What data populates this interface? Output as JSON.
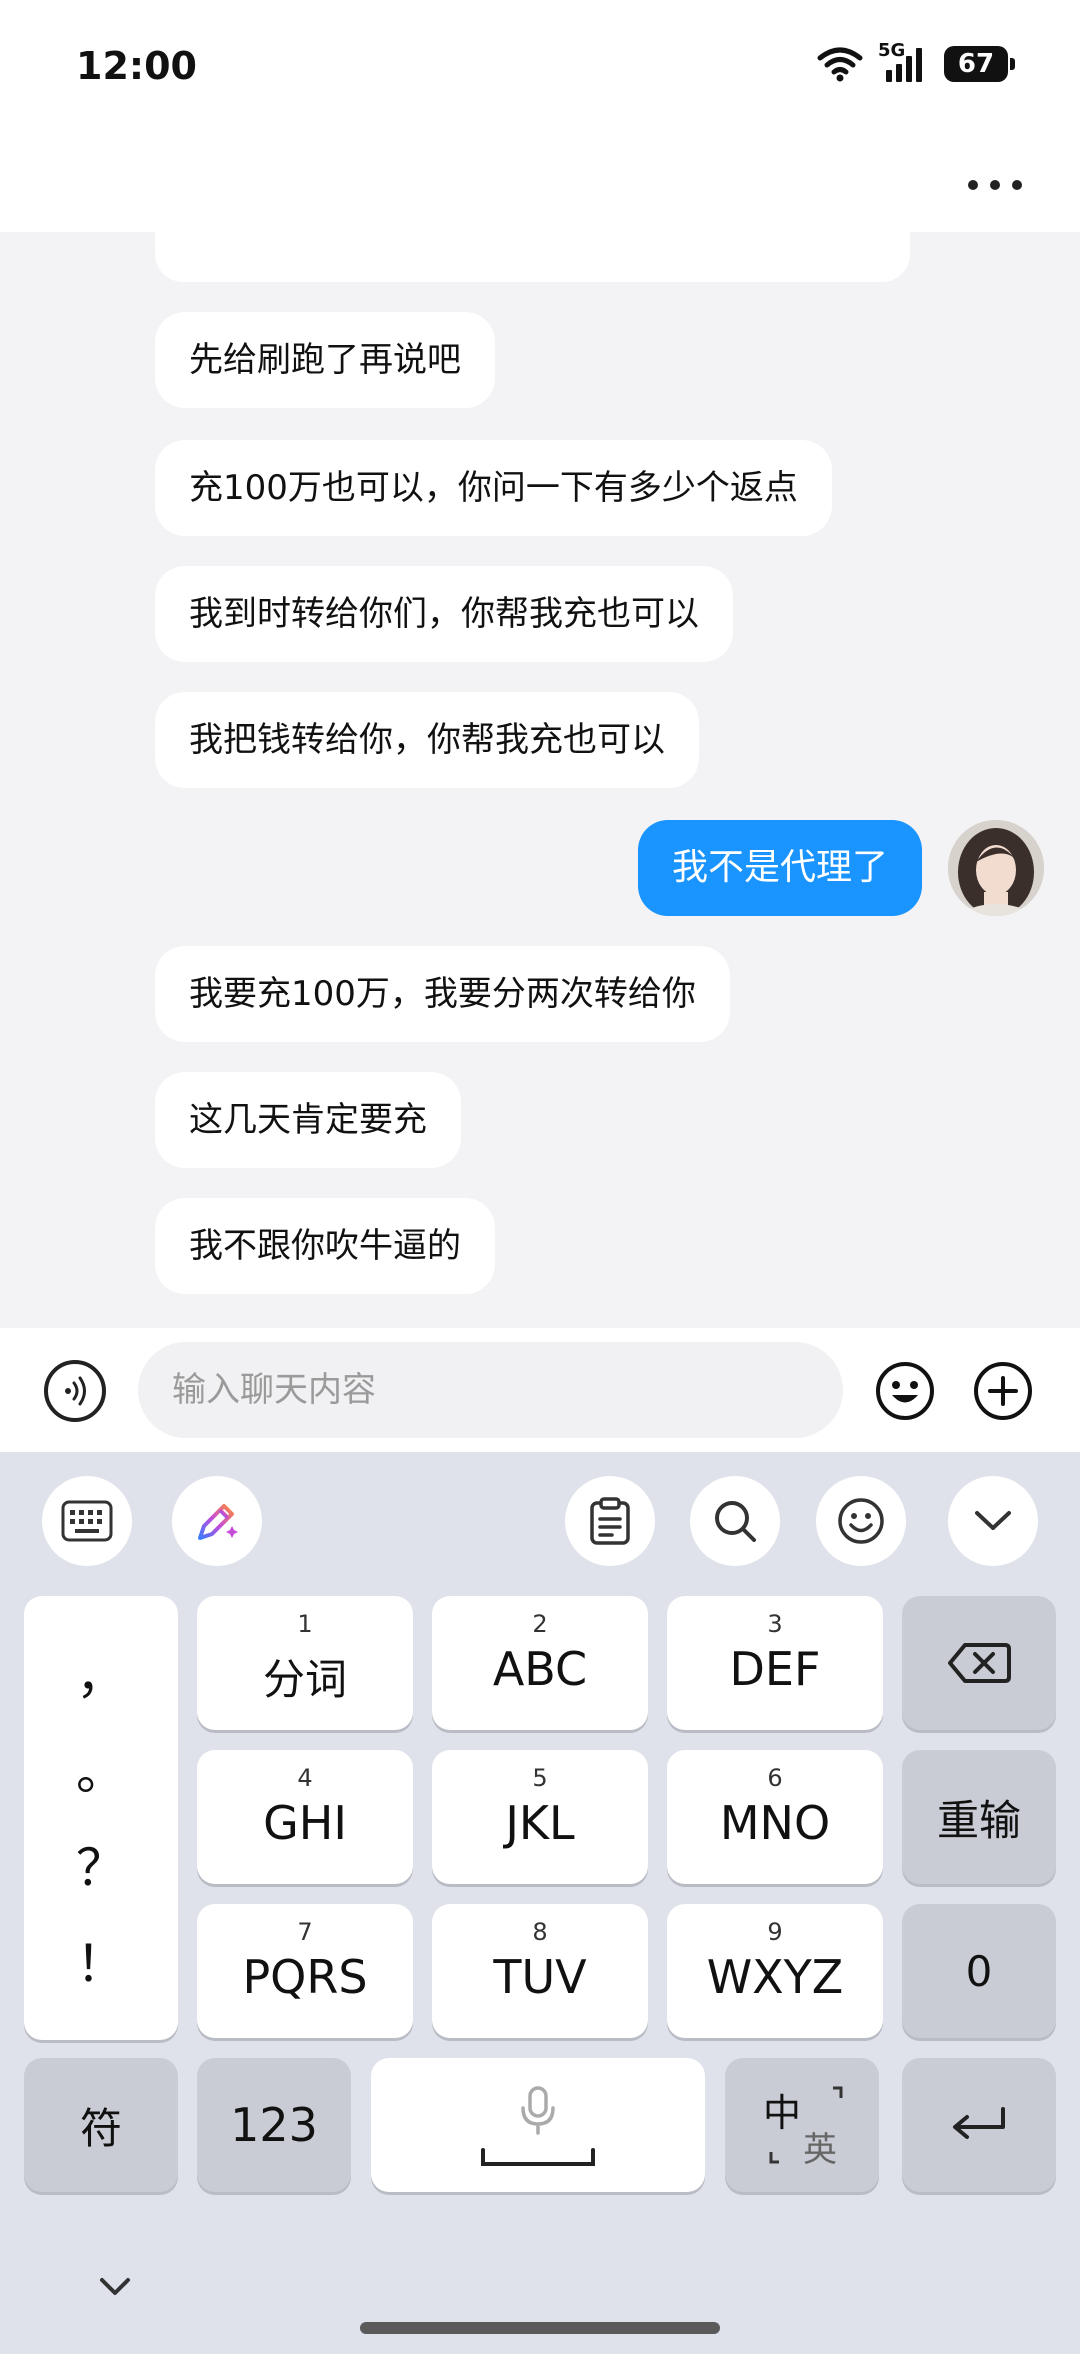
{
  "status_bar": {
    "time": "12:00",
    "network": "5G",
    "battery": "67"
  },
  "header": {
    "more_icon": "more-horizontal-icon"
  },
  "chat": {
    "messages": [
      {
        "direction": "in",
        "text": "先给刷跑了再说吧"
      },
      {
        "direction": "in",
        "text": "充100万也可以，你问一下有多少个返点"
      },
      {
        "direction": "in",
        "text": "我到时转给你们，你帮我充也可以"
      },
      {
        "direction": "in",
        "text": "我把钱转给你，你帮我充也可以"
      },
      {
        "direction": "out",
        "text": "我不是代理了"
      },
      {
        "direction": "in",
        "text": "我要充100万，我要分两次转给你"
      },
      {
        "direction": "in",
        "text": "这几天肯定要充"
      },
      {
        "direction": "in",
        "text": "我不跟你吹牛逼的"
      }
    ],
    "colors": {
      "outgoing_bubble": "#1a94ff",
      "incoming_bubble": "#ffffff",
      "background": "#f3f3f5"
    }
  },
  "input_bar": {
    "placeholder": "输入聊天内容",
    "value": ""
  },
  "keyboard": {
    "punctuation": [
      "，",
      "。",
      "？",
      "！"
    ],
    "keys": [
      {
        "num": "1",
        "label": "分词"
      },
      {
        "num": "2",
        "label": "ABC"
      },
      {
        "num": "3",
        "label": "DEF"
      },
      {
        "num": "4",
        "label": "GHI"
      },
      {
        "num": "5",
        "label": "JKL"
      },
      {
        "num": "6",
        "label": "MNO"
      },
      {
        "num": "7",
        "label": "PQRS"
      },
      {
        "num": "8",
        "label": "TUV"
      },
      {
        "num": "9",
        "label": "WXYZ"
      }
    ],
    "right_keys": {
      "delete_icon": "backspace-icon",
      "reinput": "重输",
      "zero": "0",
      "enter_icon": "return-icon"
    },
    "bottom_row": {
      "symbols": "符",
      "numbers": "123",
      "space_icon": "microphone-icon",
      "lang_zh": "中",
      "lang_en": "英"
    }
  }
}
